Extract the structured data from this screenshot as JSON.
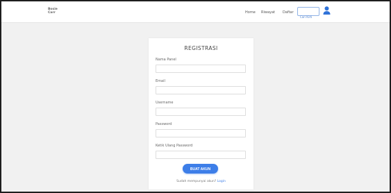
{
  "brand": {
    "line1": "Bosie",
    "line2": "Carr"
  },
  "nav": {
    "links": [
      "Home",
      "Riwayat",
      "Daftar"
    ],
    "search_placeholder": "Cari Kirti"
  },
  "form": {
    "title": "REGISTRASI",
    "fields": [
      {
        "label": "Nama Panel",
        "value": ""
      },
      {
        "label": "Email",
        "value": ""
      },
      {
        "label": "Username",
        "value": ""
      },
      {
        "label": "Password",
        "value": ""
      },
      {
        "label": "Ketik Ulang Password",
        "value": ""
      }
    ],
    "submit_label": "BUAT AKUN",
    "login_prompt": "Sudah mempunyai akun?",
    "login_link": "Login"
  },
  "colors": {
    "accent": "#3d7ee8",
    "user_icon": "#2f72d8",
    "page_bg": "#f1f1f1"
  },
  "icons": {
    "user": "user-icon"
  }
}
